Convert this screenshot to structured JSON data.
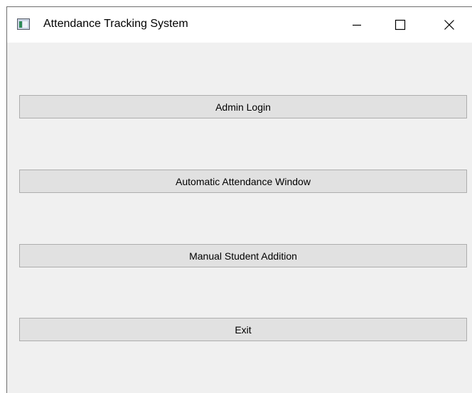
{
  "window": {
    "title": "Attendance Tracking System",
    "icon": "app-window-icon",
    "controls": {
      "minimize_icon": "minimize-icon",
      "maximize_icon": "maximize-icon",
      "close_icon": "close-icon"
    }
  },
  "main": {
    "buttons": [
      {
        "label": "Admin Login"
      },
      {
        "label": "Automatic Attendance Window"
      },
      {
        "label": "Manual Student Addition"
      },
      {
        "label": "Exit"
      }
    ]
  },
  "colors": {
    "window_background": "#f0f0f0",
    "titlebar_background": "#ffffff",
    "button_background": "#e1e1e1",
    "button_border": "#adadad"
  }
}
